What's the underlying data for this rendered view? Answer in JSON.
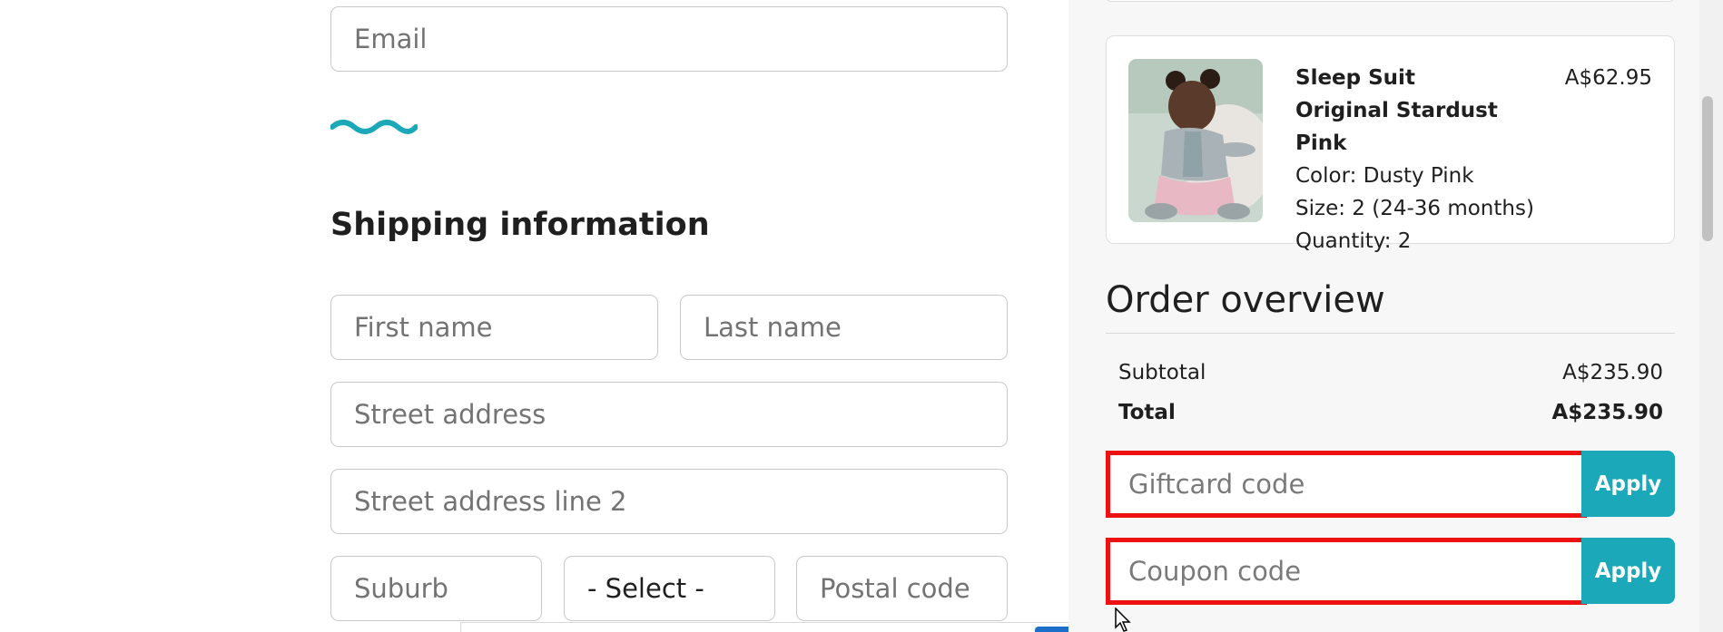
{
  "form": {
    "email_placeholder": "Email",
    "section_title": "Shipping information",
    "first_name_placeholder": "First name",
    "last_name_placeholder": "Last name",
    "street_placeholder": "Street address",
    "street2_placeholder": "Street address line 2",
    "suburb_placeholder": "Suburb",
    "state_select_value": "- Select -",
    "postal_placeholder": "Postal code"
  },
  "cart_item": {
    "name": "Sleep Suit Original Stardust Pink",
    "price": "A$62.95",
    "color": "Color: Dusty Pink",
    "size": "Size: 2 (24-36 months)",
    "quantity": "Quantity: 2"
  },
  "overview": {
    "title": "Order overview",
    "subtotal_label": "Subtotal",
    "subtotal_value": "A$235.90",
    "total_label": "Total",
    "total_value": "A$235.90",
    "giftcard_placeholder": "Giftcard code",
    "giftcard_apply": "Apply",
    "coupon_placeholder": "Coupon code",
    "coupon_apply": "Apply"
  },
  "colors": {
    "accent": "#1ba8b8",
    "highlight": "#ee1111"
  }
}
